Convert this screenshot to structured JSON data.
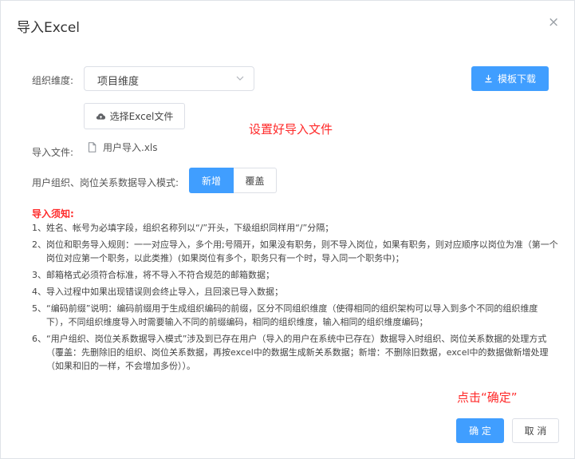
{
  "dialog": {
    "title": "导入Excel",
    "close_glyph": "×"
  },
  "form": {
    "dimension_label": "组织维度:",
    "dimension_value": "项目维度",
    "download_button": "模板下载",
    "choose_file_button": "选择Excel文件",
    "hint_text": "设置好导入文件",
    "import_file_label": "导入文件:",
    "file_name": "用户导入.xls",
    "mode_label": "用户组织、岗位关系数据导入模式:",
    "mode_options": [
      "新增",
      "覆盖"
    ],
    "mode_selected": "新增"
  },
  "notice": {
    "title": "导入须知:",
    "items": [
      {
        "num": "1、",
        "text": "姓名、帐号为必填字段，组织名称列以“/”开头，下级组织同样用“/”分隔；"
      },
      {
        "num": "2、",
        "text": "岗位和职务导入规则：一一对应导入，多个用;号隔开，如果没有职务，则不导入岗位，如果有职务，则对应顺序以岗位为准（第一个岗位对应第一个职务，以此类推）(如果岗位有多个，职务只有一个时，导入同一个职务中)；"
      },
      {
        "num": "3、",
        "text": "邮箱格式必须符合标准，将不导入不符合规范的邮箱数据；"
      },
      {
        "num": "4、",
        "text": "导入过程中如果出现错误则会终止导入，且回滚已导入数据；"
      },
      {
        "num": "5、",
        "text": "“编码前缀”说明：编码前缀用于生成组织编码的前缀，区分不同组织维度（使得相同的组织架构可以导入到多个不同的组织维度下），不同组织维度导入时需要输入不同的前缀编码，相同的组织维度，输入相同的组织维度编码；"
      },
      {
        "num": "6、",
        "text": "“用户组织、岗位关系数据导入模式”涉及到已存在用户（导入的用户在系统中已存在）数据导入时组织、岗位关系数据的处理方式（覆盖：先删除旧的组织、岗位关系数据，再按excel中的数据生成新关系数据；新增：不删除旧数据，excel中的数据做新增处理（如果和旧的一样，不会增加多份））。"
      }
    ]
  },
  "footer": {
    "hint_text": "点击“确定”",
    "confirm_button": "确 定",
    "cancel_button": "取 消"
  },
  "colors": {
    "primary": "#409eff",
    "annotation_red": "#ff2a2a",
    "border": "#dcdfe6"
  },
  "icons": [
    "close-icon",
    "chevron-down-icon",
    "download-icon",
    "cloud-upload-icon",
    "file-icon"
  ]
}
